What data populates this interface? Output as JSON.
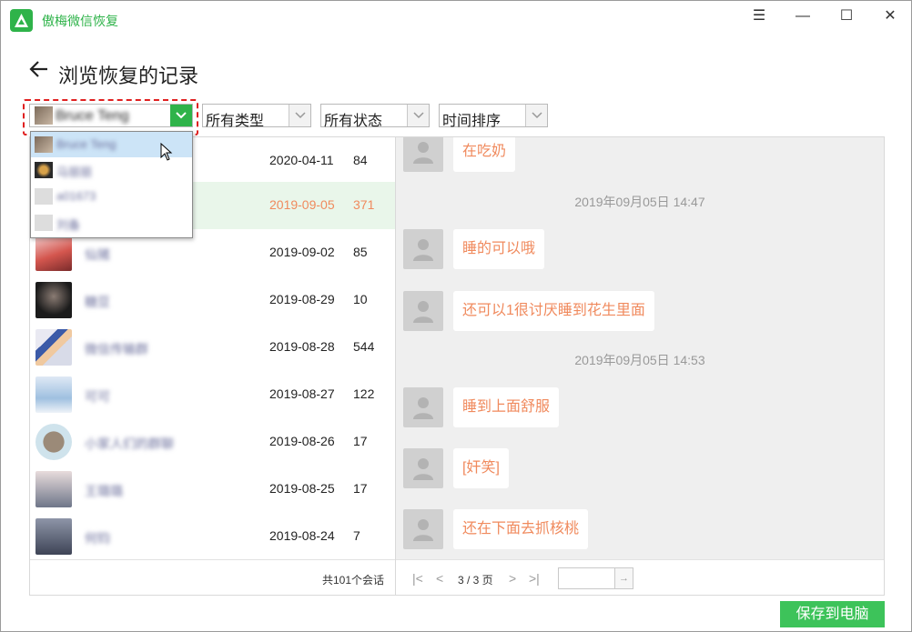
{
  "app": {
    "title": "傲梅微信恢复",
    "accent": "#2fb34a"
  },
  "window_controls": {
    "menu": "☰",
    "minimize": "—",
    "maximize": "☐",
    "close": "✕"
  },
  "header": {
    "back_icon": "arrow-left-icon",
    "title": "浏览恢复的记录"
  },
  "filters": {
    "contact": {
      "value": "Bruce Teng"
    },
    "type": {
      "value": "所有类型"
    },
    "status": {
      "value": "所有状态"
    },
    "sort": {
      "value": "时间排序"
    }
  },
  "dropdown": {
    "items": [
      {
        "name": "Bruce Teng"
      },
      {
        "name": "马丽丽"
      },
      {
        "name": "a01673"
      },
      {
        "name": "刘备"
      }
    ]
  },
  "sessions": [
    {
      "name": "",
      "date": "2020-04-11",
      "count": "84"
    },
    {
      "name": "",
      "date": "2019-09-05",
      "count": "371",
      "active": true
    },
    {
      "name": "仙猪",
      "date": "2019-09-02",
      "count": "85"
    },
    {
      "name": "糖豆",
      "date": "2019-08-29",
      "count": "10"
    },
    {
      "name": "微信传输群",
      "date": "2019-08-28",
      "count": "544"
    },
    {
      "name": "可可",
      "date": "2019-08-27",
      "count": "122"
    },
    {
      "name": "小家人们的群聊",
      "date": "2019-08-26",
      "count": "17"
    },
    {
      "name": "王璐璐",
      "date": "2019-08-25",
      "count": "17"
    },
    {
      "name": "何钧",
      "date": "2019-08-24",
      "count": "7"
    }
  ],
  "left_footer": {
    "total": "共101个会话"
  },
  "chat": {
    "messages": [
      {
        "text": "在吃奶"
      },
      {
        "timestamp": "2019年09月05日 14:47"
      },
      {
        "text": "睡的可以哦"
      },
      {
        "text": "还可以1很讨厌睡到花生里面"
      },
      {
        "timestamp": "2019年09月05日 14:53"
      },
      {
        "text": "睡到上面舒服"
      },
      {
        "text": "[奸笑]"
      },
      {
        "text": "还在下面去抓核桃"
      }
    ],
    "bubble_text_color": "#f08a5d"
  },
  "pager": {
    "first": "|<",
    "prev": "<",
    "info": "3 / 3 页",
    "next": ">",
    "last": ">|",
    "go": "→"
  },
  "actions": {
    "save": "保存到电脑"
  }
}
